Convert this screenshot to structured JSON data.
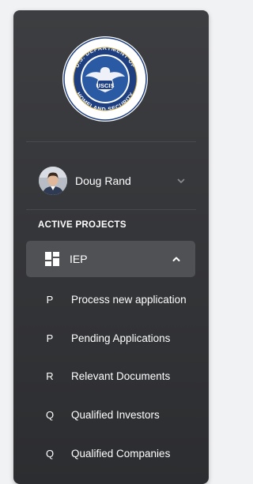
{
  "logo": {
    "alt": "U.S. Department of Homeland Security seal",
    "ring_text_top": "U.S. DEPARTMENT OF",
    "ring_text_bottom": "HOMELAND SECURITY",
    "center_text": "USCIS"
  },
  "user": {
    "name": "Doug Rand",
    "chevron_icon": "chevron-down-icon"
  },
  "active_projects": {
    "title": "ACTIVE PROJECTS",
    "project": {
      "label": "IEP",
      "icon": "dashboard-grid-icon",
      "chevron_icon": "chevron-up-icon"
    },
    "items": [
      {
        "initial": "P",
        "label": "Process new application"
      },
      {
        "initial": "P",
        "label": "Pending Applications"
      },
      {
        "initial": "R",
        "label": "Relevant Documents"
      },
      {
        "initial": "Q",
        "label": "Qualified Investors"
      },
      {
        "initial": "Q",
        "label": "Qualified Companies"
      }
    ]
  },
  "colors": {
    "page_background": "#f1f2f4",
    "sidebar_top": "#3d3e41",
    "sidebar_bottom": "#2c2d30",
    "active_item": "#505155",
    "text": "#ffffff"
  }
}
